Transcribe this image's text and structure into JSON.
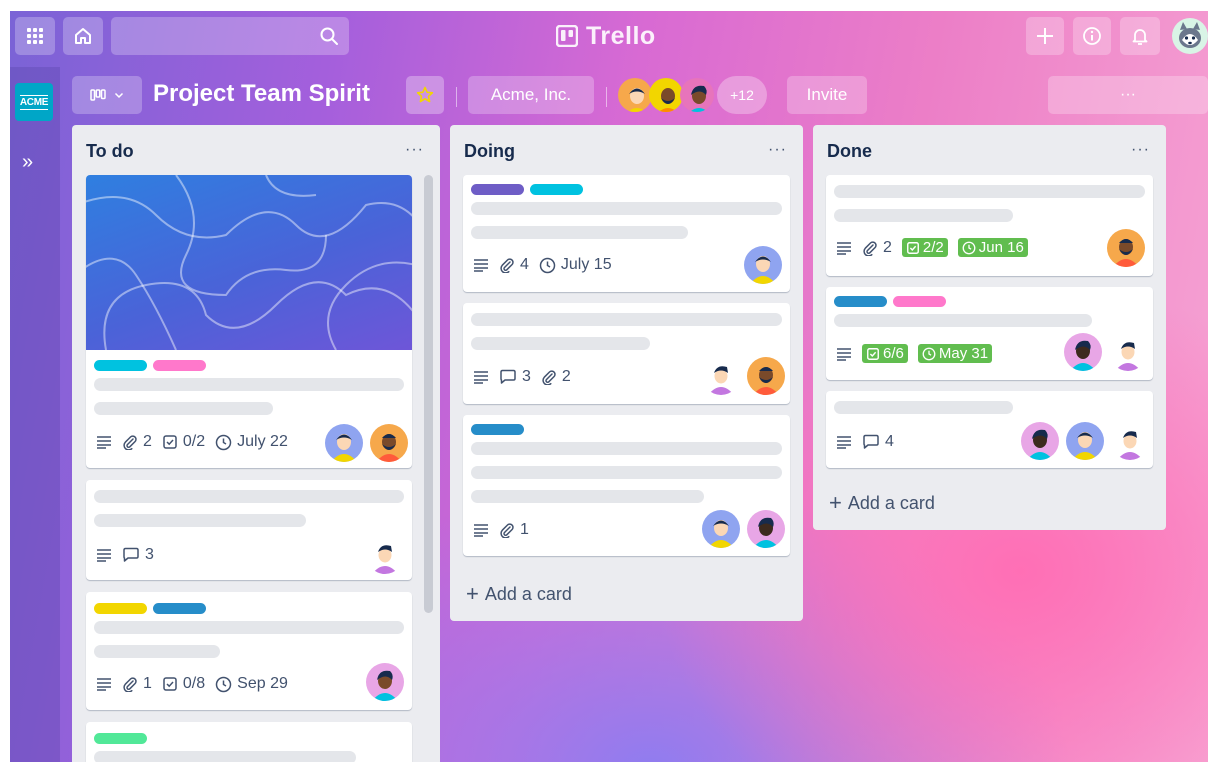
{
  "app": {
    "name": "Trello"
  },
  "topbar": {
    "icons": [
      "grid-icon",
      "home-icon",
      "search-icon",
      "plus-icon",
      "info-icon",
      "bell-icon"
    ]
  },
  "sidebar": {
    "workspace_badge": "ACME",
    "expand_icon": "»"
  },
  "board": {
    "title": "Project Team Spirit",
    "workspace": "Acme, Inc.",
    "extra_members": "+12",
    "invite_label": "Invite",
    "menu_label": "···"
  },
  "colors": {
    "teal": "#00c2e0",
    "pink": "#ff78cb",
    "purple": "#6e5dc6",
    "blue": "#0079bf",
    "yellow": "#f2d600",
    "green": "#61bd4f",
    "mint": "#51e898"
  },
  "lists": [
    {
      "title": "To do",
      "menu": "···",
      "cards": [
        {
          "labels": [
            "teal",
            "pink"
          ],
          "attachments": "2",
          "checklist": "0/2",
          "due": "July 22"
        },
        {
          "comments": "3"
        },
        {
          "labels": [
            "yellow",
            "blue"
          ],
          "attachments": "1",
          "checklist": "0/8",
          "due": "Sep 29"
        },
        {
          "labels": [
            "mint"
          ]
        }
      ]
    },
    {
      "title": "Doing",
      "menu": "···",
      "cards": [
        {
          "labels": [
            "purple",
            "teal"
          ],
          "attachments": "4",
          "due": "July 15"
        },
        {
          "comments": "3",
          "attachments": "2"
        },
        {
          "labels": [
            "blue"
          ],
          "attachments": "1"
        }
      ],
      "add_card": "Add a card"
    },
    {
      "title": "Done",
      "menu": "···",
      "cards": [
        {
          "attachments": "2",
          "checklist": "2/2",
          "due": "Jun 16"
        },
        {
          "labels": [
            "blue",
            "pink"
          ],
          "checklist": "6/6",
          "due": "May 31"
        },
        {
          "comments": "4"
        }
      ],
      "add_card": "Add a card"
    }
  ]
}
